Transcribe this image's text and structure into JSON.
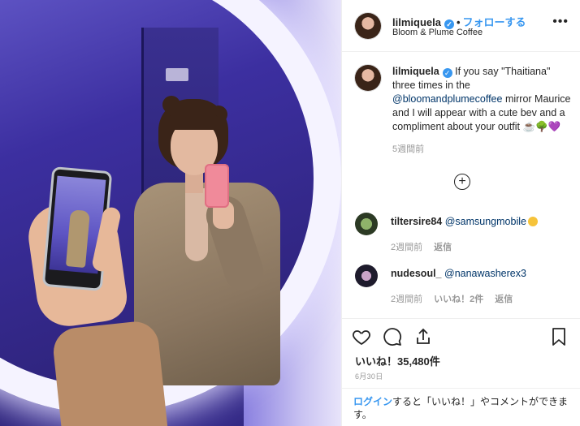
{
  "header": {
    "username": "lilmiquela",
    "separator": "•",
    "follow_label": "フォローする",
    "location": "Bloom & Plume Coffee",
    "more_label": "•••"
  },
  "caption": {
    "username": "lilmiquela",
    "text_before": " If you say \"Thaitiana\" three times in the ",
    "mention": "@bloomandplumecoffee",
    "text_after": " mirror Maurice and I will appear with a cute bev and a compliment about your outfit ☕🌳💜",
    "time": "5週間前"
  },
  "load_more_label": "+",
  "comments": [
    {
      "username": "tiltersire84",
      "mention": "@samsungmobile",
      "time": "2週間前",
      "reply_label": "返信",
      "likes_label": ""
    },
    {
      "username": "nudesoul_",
      "mention": "@nanawasherex3",
      "time": "2週間前",
      "likes_label": "いいね！2件",
      "reply_label": "返信"
    }
  ],
  "actions": {
    "icons": [
      "heart-icon",
      "comment-icon",
      "share-icon",
      "bookmark-icon"
    ],
    "likes_text": "いいね！35,480件",
    "date": "6月30日"
  },
  "login_prompt": {
    "link": "ログイン",
    "text": "すると「いいね！」やコメントができます。"
  },
  "colors": {
    "link_blue": "#3897f0",
    "text": "#262626",
    "muted": "#999999"
  }
}
